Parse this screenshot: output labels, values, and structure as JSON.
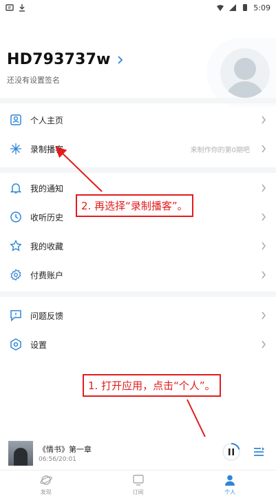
{
  "status_bar": {
    "time": "5:09"
  },
  "profile": {
    "username": "HD793737w",
    "signature": "还没有设置签名"
  },
  "menu": {
    "group1": [
      {
        "label": "个人主页",
        "hint": "",
        "icon": "user-card-icon"
      },
      {
        "label": "录制播客",
        "hint": "来制作你的第0期吧",
        "icon": "sparkle-icon"
      }
    ],
    "group2": [
      {
        "label": "我的通知",
        "icon": "bell-icon"
      },
      {
        "label": "收听历史",
        "icon": "clock-icon"
      },
      {
        "label": "我的收藏",
        "icon": "star-icon"
      },
      {
        "label": "付费账户",
        "icon": "gear-badge-icon"
      }
    ],
    "group3": [
      {
        "label": "问题反馈",
        "icon": "feedback-icon"
      },
      {
        "label": "设置",
        "icon": "settings-icon"
      }
    ]
  },
  "annotations": {
    "step1": "1. 打开应用，点击“个人”。",
    "step2": "2. 再选择“录制播客”。"
  },
  "player": {
    "title": "《情书》第一章",
    "time": "06:56/20:01"
  },
  "tabs": [
    {
      "label": "发现",
      "icon": "planet-icon",
      "active": false
    },
    {
      "label": "订阅",
      "icon": "tv-icon",
      "active": false
    },
    {
      "label": "个人",
      "icon": "person-icon",
      "active": true
    }
  ],
  "colors": {
    "accent": "#2f86d8",
    "annotation": "#e21b1b"
  }
}
